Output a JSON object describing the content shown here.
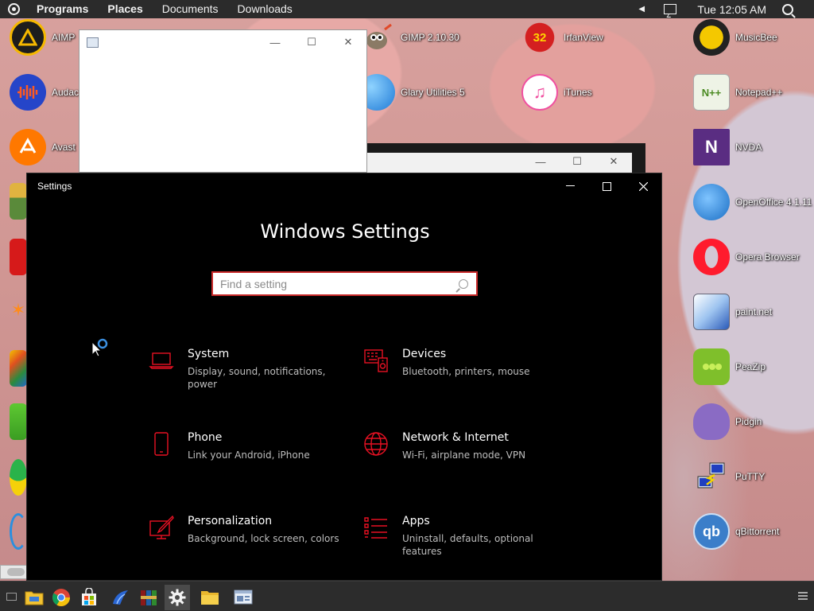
{
  "top_panel": {
    "menus": [
      "Programs",
      "Places",
      "Documents",
      "Downloads"
    ],
    "clock": "Tue 12:05 AM"
  },
  "desktop_icons": [
    {
      "label": "AIMP",
      "icon": "aimp-icon",
      "color": "#f5b800"
    },
    {
      "label": "Audac",
      "icon": "audacity-icon",
      "color": "#2545c9"
    },
    {
      "label": "Avast",
      "icon": "avast-icon",
      "color": "#ff7800"
    },
    {
      "label": "GIMP 2.10.30",
      "icon": "gimp-icon",
      "color": "#7a6a55"
    },
    {
      "label": "Glary Utilities 5",
      "icon": "glary-icon",
      "color": "#2f8fe0"
    },
    {
      "label": "IrfanView",
      "icon": "irfanview-icon",
      "color": "#cc2222"
    },
    {
      "label": "iTunes",
      "icon": "itunes-icon",
      "color": "#f04fa0"
    },
    {
      "label": "MusicBee",
      "icon": "musicbee-icon",
      "color": "#f2c200"
    },
    {
      "label": "Notepad++",
      "icon": "notepadpp-icon",
      "color": "#79b93e"
    },
    {
      "label": "NVDA",
      "icon": "nvda-icon",
      "color": "#5a2d82"
    },
    {
      "label": "OpenOffice 4.1.11",
      "icon": "openoffice-icon",
      "color": "#1e88e5"
    },
    {
      "label": "Opera Browser",
      "icon": "opera-icon",
      "color": "#ff1b2d"
    },
    {
      "label": "paint.net",
      "icon": "paintnet-icon",
      "color": "#3a6fc4"
    },
    {
      "label": "PeaZip",
      "icon": "peazip-icon",
      "color": "#7fbf2b"
    },
    {
      "label": "Pidgin",
      "icon": "pidgin-icon",
      "color": "#8a6bc4"
    },
    {
      "label": "PuTTY",
      "icon": "putty-icon",
      "color": "#3a5fcd"
    },
    {
      "label": "qBittorrent",
      "icon": "qbittorrent-icon",
      "color": "#3b7ec9"
    }
  ],
  "settings": {
    "window_title": "Settings",
    "heading": "Windows Settings",
    "search_placeholder": "Find a setting",
    "accent": "#e81123",
    "tiles": [
      {
        "name": "System",
        "desc": "Display, sound, notifications, power",
        "icon": "laptop-icon"
      },
      {
        "name": "Devices",
        "desc": "Bluetooth, printers, mouse",
        "icon": "devices-icon"
      },
      {
        "name": "Phone",
        "desc": "Link your Android, iPhone",
        "icon": "phone-icon"
      },
      {
        "name": "Network & Internet",
        "desc": "Wi-Fi, airplane mode, VPN",
        "icon": "globe-icon"
      },
      {
        "name": "Personalization",
        "desc": "Background, lock screen, colors",
        "icon": "paintbrush-icon"
      },
      {
        "name": "Apps",
        "desc": "Uninstall, defaults, optional features",
        "icon": "apps-list-icon"
      }
    ]
  },
  "taskbar": {
    "items": [
      "file-manager-icon",
      "chrome-icon",
      "store-icon",
      "bird-icon",
      "winrar-icon",
      "settings-gear-icon",
      "folder-icon",
      "window-app-icon"
    ],
    "active_index": 5
  }
}
